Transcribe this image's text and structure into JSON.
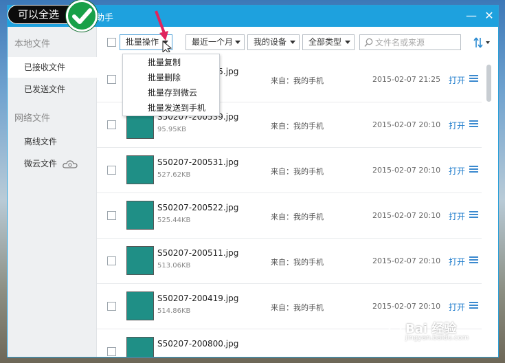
{
  "window": {
    "title_suffix": "助手"
  },
  "overlay": {
    "badge_label": "可以全选"
  },
  "sidebar": {
    "local_group": "本地文件",
    "network_group": "网络文件",
    "items": [
      {
        "label": "已接收文件",
        "active": true
      },
      {
        "label": "已发送文件",
        "active": false
      },
      {
        "label": "离线文件",
        "active": false
      },
      {
        "label": "微云文件",
        "active": false
      }
    ]
  },
  "toolbar": {
    "batch_label": "批量操作",
    "time_filter": "最近一个月",
    "device_filter": "我的设备",
    "type_filter": "全部类型",
    "search_placeholder": "文件名或来源"
  },
  "batch_menu": {
    "items": [
      "批量复制",
      "批量删除",
      "批量存到微云",
      "批量发送到手机"
    ]
  },
  "files": [
    {
      "name": "S50207-212035.jpg",
      "size": "",
      "source": "来自：我的手机",
      "date": "2015-02-07 21:25",
      "open": "打开"
    },
    {
      "name": "S50207-200539.jpg",
      "size": "95.95KB",
      "source": "来自：我的手机",
      "date": "2015-02-07 20:10",
      "open": "打开"
    },
    {
      "name": "S50207-200531.jpg",
      "size": "527.62KB",
      "source": "来自：我的手机",
      "date": "2015-02-07 20:10",
      "open": "打开"
    },
    {
      "name": "S50207-200522.jpg",
      "size": "525.44KB",
      "source": "来自：我的手机",
      "date": "2015-02-07 20:10",
      "open": "打开"
    },
    {
      "name": "S50207-200511.jpg",
      "size": "513.06KB",
      "source": "来自：我的手机",
      "date": "2015-02-07 20:10",
      "open": "打开"
    },
    {
      "name": "S50207-200419.jpg",
      "size": "514.86KB",
      "source": "来自：我的手机",
      "date": "2015-02-07 20:10",
      "open": "打开"
    },
    {
      "name": "S50207-200800.jpg",
      "size": "",
      "source": "",
      "date": "",
      "open": ""
    }
  ],
  "watermark": {
    "brand": "Bai 经验",
    "domain": "jingyan.baidu.com"
  },
  "colors": {
    "titlebar": "#1ea1de",
    "link": "#1f7ccc",
    "badge_check": "#18a048",
    "arrow": "#e0245e"
  }
}
